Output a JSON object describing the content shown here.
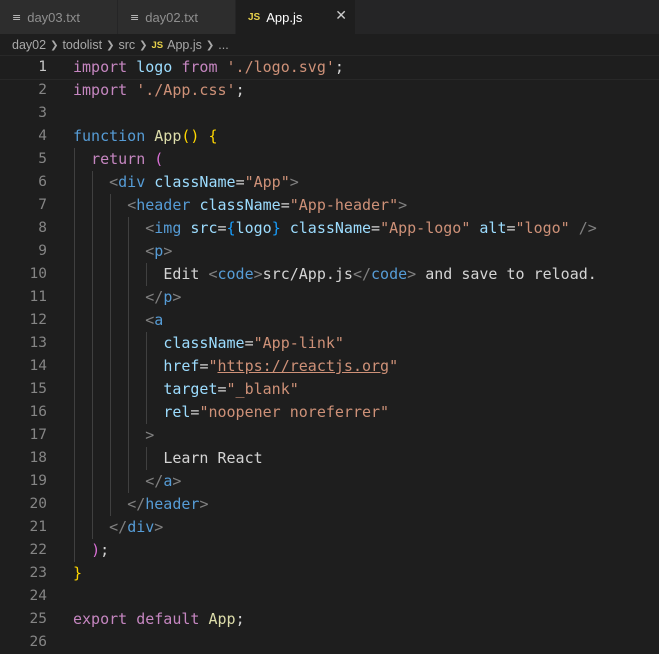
{
  "tabs": [
    {
      "label": "day03.txt",
      "icon": "text-file-icon",
      "active": false
    },
    {
      "label": "day02.txt",
      "icon": "text-file-icon",
      "active": false
    },
    {
      "label": "App.js",
      "icon": "js-file-icon",
      "active": true
    }
  ],
  "tab_icon_js": "JS",
  "tab_icon_txt": "≡",
  "close_glyph": "✕",
  "breadcrumb": {
    "items": [
      "day02",
      "todolist",
      "src",
      "App.js",
      "..."
    ],
    "js_badge": "JS"
  },
  "lines": [
    {
      "n": "1"
    },
    {
      "n": "2"
    },
    {
      "n": "3"
    },
    {
      "n": "4"
    },
    {
      "n": "5"
    },
    {
      "n": "6"
    },
    {
      "n": "7"
    },
    {
      "n": "8"
    },
    {
      "n": "9"
    },
    {
      "n": "10"
    },
    {
      "n": "11"
    },
    {
      "n": "12"
    },
    {
      "n": "13"
    },
    {
      "n": "14"
    },
    {
      "n": "15"
    },
    {
      "n": "16"
    },
    {
      "n": "17"
    },
    {
      "n": "18"
    },
    {
      "n": "19"
    },
    {
      "n": "20"
    },
    {
      "n": "21"
    },
    {
      "n": "22"
    },
    {
      "n": "23"
    },
    {
      "n": "24"
    },
    {
      "n": "25"
    },
    {
      "n": "26"
    }
  ],
  "code": {
    "l1": [
      "import",
      "logo",
      "from",
      "'./logo.svg'",
      ";"
    ],
    "l2": [
      "import",
      "'./App.css'",
      ";"
    ],
    "l4": [
      "function",
      "App",
      "(",
      ")",
      "{"
    ],
    "l5": [
      "return",
      "("
    ],
    "l6": [
      "<",
      "div",
      "className",
      "=",
      "\"App\"",
      ">"
    ],
    "l7": [
      "<",
      "header",
      "className",
      "=",
      "\"App-header\"",
      ">"
    ],
    "l8": [
      "<",
      "img",
      "src",
      "=",
      "{",
      "logo",
      "}",
      "className",
      "=",
      "\"App-logo\"",
      "alt",
      "=",
      "\"logo\"",
      "/>"
    ],
    "l9": [
      "<",
      "p",
      ">"
    ],
    "l10": [
      "Edit ",
      "<",
      "code",
      ">",
      "src/App.js",
      "</",
      "code",
      ">",
      " and save to reload."
    ],
    "l11": [
      "</",
      "p",
      ">"
    ],
    "l12": [
      "<",
      "a"
    ],
    "l13": [
      "className",
      "=",
      "\"App-link\""
    ],
    "l14": [
      "href",
      "=",
      "\"",
      "https://reactjs.org",
      "\""
    ],
    "l15": [
      "target",
      "=",
      "\"_blank\""
    ],
    "l16": [
      "rel",
      "=",
      "\"noopener noreferrer\""
    ],
    "l17": [
      ">"
    ],
    "l18": [
      "Learn React"
    ],
    "l19": [
      "</",
      "a",
      ">"
    ],
    "l20": [
      "</",
      "header",
      ">"
    ],
    "l21": [
      "</",
      "div",
      ">"
    ],
    "l22": [
      ")",
      ";"
    ],
    "l23": [
      "}"
    ],
    "l25": [
      "export",
      "default",
      "App",
      ";"
    ]
  },
  "colors": {
    "background": "#1e1e1e",
    "keyword": "#c586c0",
    "storage": "#569cd6",
    "function": "#dcdcaa",
    "string": "#ce9178",
    "variable": "#9cdcfe"
  }
}
